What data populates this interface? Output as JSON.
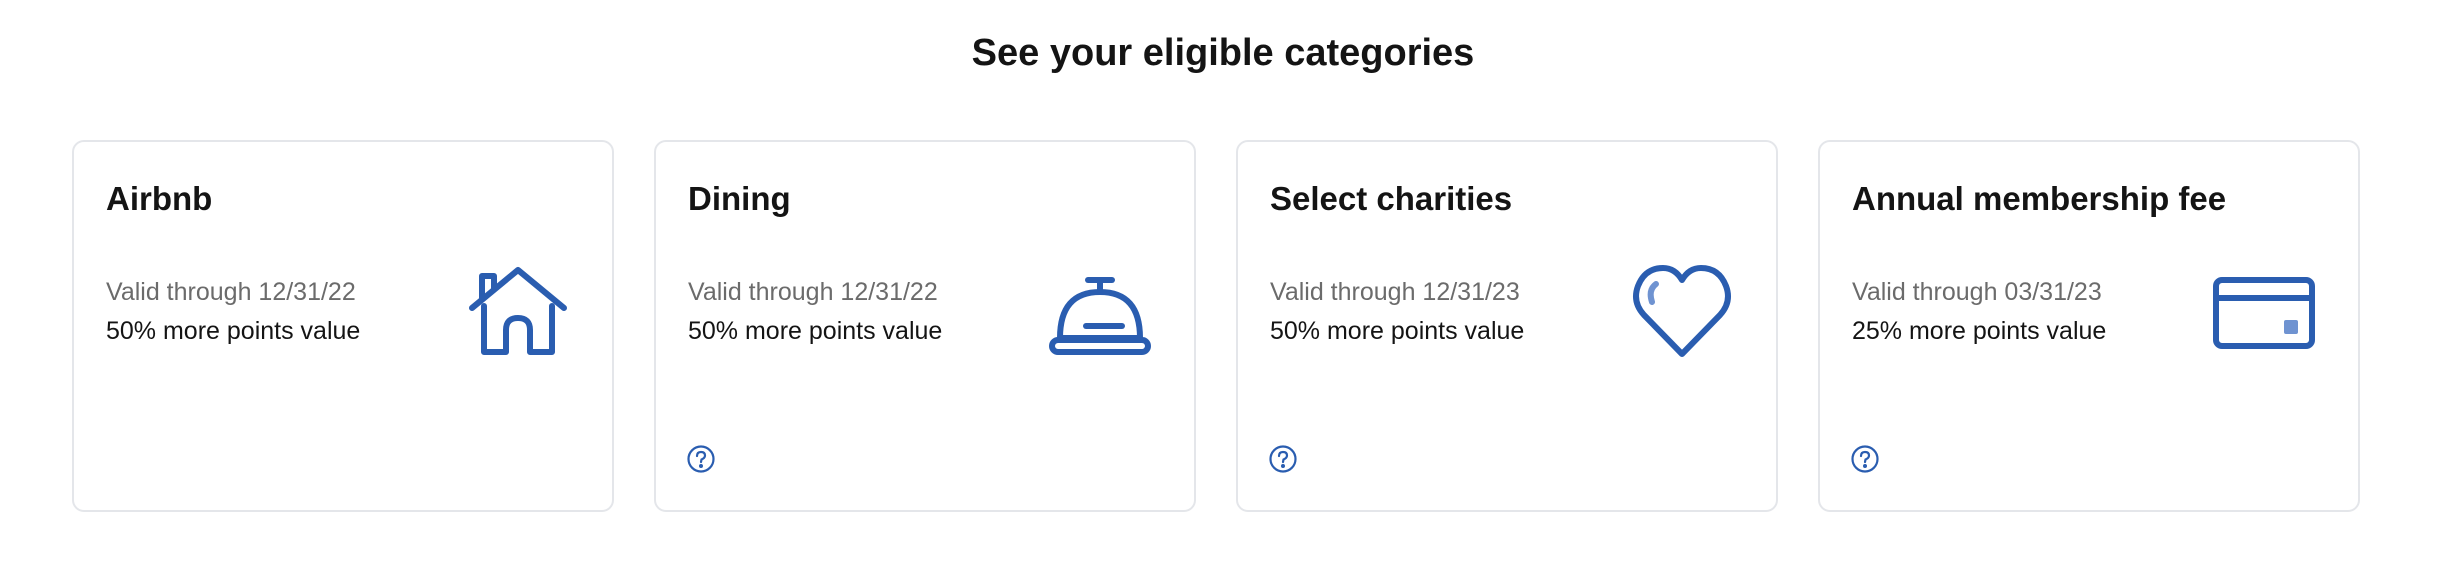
{
  "section": {
    "title": "See your eligible categories"
  },
  "colors": {
    "accent": "#2a5db0",
    "accent_light": "#6f93d1",
    "border": "#e4e6ea"
  },
  "cards": [
    {
      "title": "Airbnb",
      "validity": "Valid through 12/31/22",
      "value": "50% more points value",
      "icon": "house-icon",
      "has_help": false
    },
    {
      "title": "Dining",
      "validity": "Valid through 12/31/22",
      "value": "50% more points value",
      "icon": "service-bell-icon",
      "has_help": true,
      "help_icon": "question-circle-icon"
    },
    {
      "title": "Select charities",
      "validity": "Valid through 12/31/23",
      "value": "50% more points value",
      "icon": "heart-icon",
      "has_help": true,
      "help_icon": "question-circle-icon"
    },
    {
      "title": "Annual membership fee",
      "validity": "Valid through 03/31/23",
      "value": "25% more points value",
      "icon": "credit-card-icon",
      "has_help": true,
      "help_icon": "question-circle-icon"
    }
  ]
}
